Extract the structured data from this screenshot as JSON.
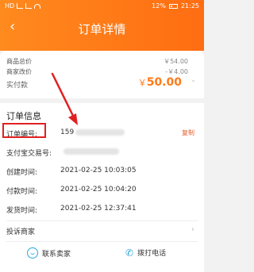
{
  "status": {
    "left": "HD",
    "battery_text": "12%",
    "time": "21:25"
  },
  "nav": {
    "back_icon": "‹",
    "title": "订单详情"
  },
  "summary": {
    "total_label": "商品总价",
    "total_value": "￥54.00",
    "discount_label": "商家改价",
    "discount_value": "-￥4.00",
    "paid_label": "实付款",
    "paid_symbol": "￥",
    "paid_value": "50.00"
  },
  "order_info": {
    "title": "订单信息",
    "order_no_label": "订单编号:",
    "order_no_value": "159",
    "copy_label": "复制",
    "alipay_label": "支付宝交易号:",
    "created_label": "创建时间:",
    "created_value": "2021-02-25 10:03:05",
    "paid_label": "付款时间:",
    "paid_value": "2021-02-25 10:04:20",
    "shipped_label": "发货时间:",
    "shipped_value": "2021-02-25 12:37:41",
    "complain_label": "投诉商家"
  },
  "actions": {
    "contact_seller": "联系卖家",
    "call_phone": "拨打电话"
  },
  "colors": {
    "header_start": "#ff8a1e",
    "header_end": "#ff6d12",
    "accent": "#ff7a1a",
    "highlight_box": "#e02020",
    "icon_blue": "#29a7e1"
  }
}
